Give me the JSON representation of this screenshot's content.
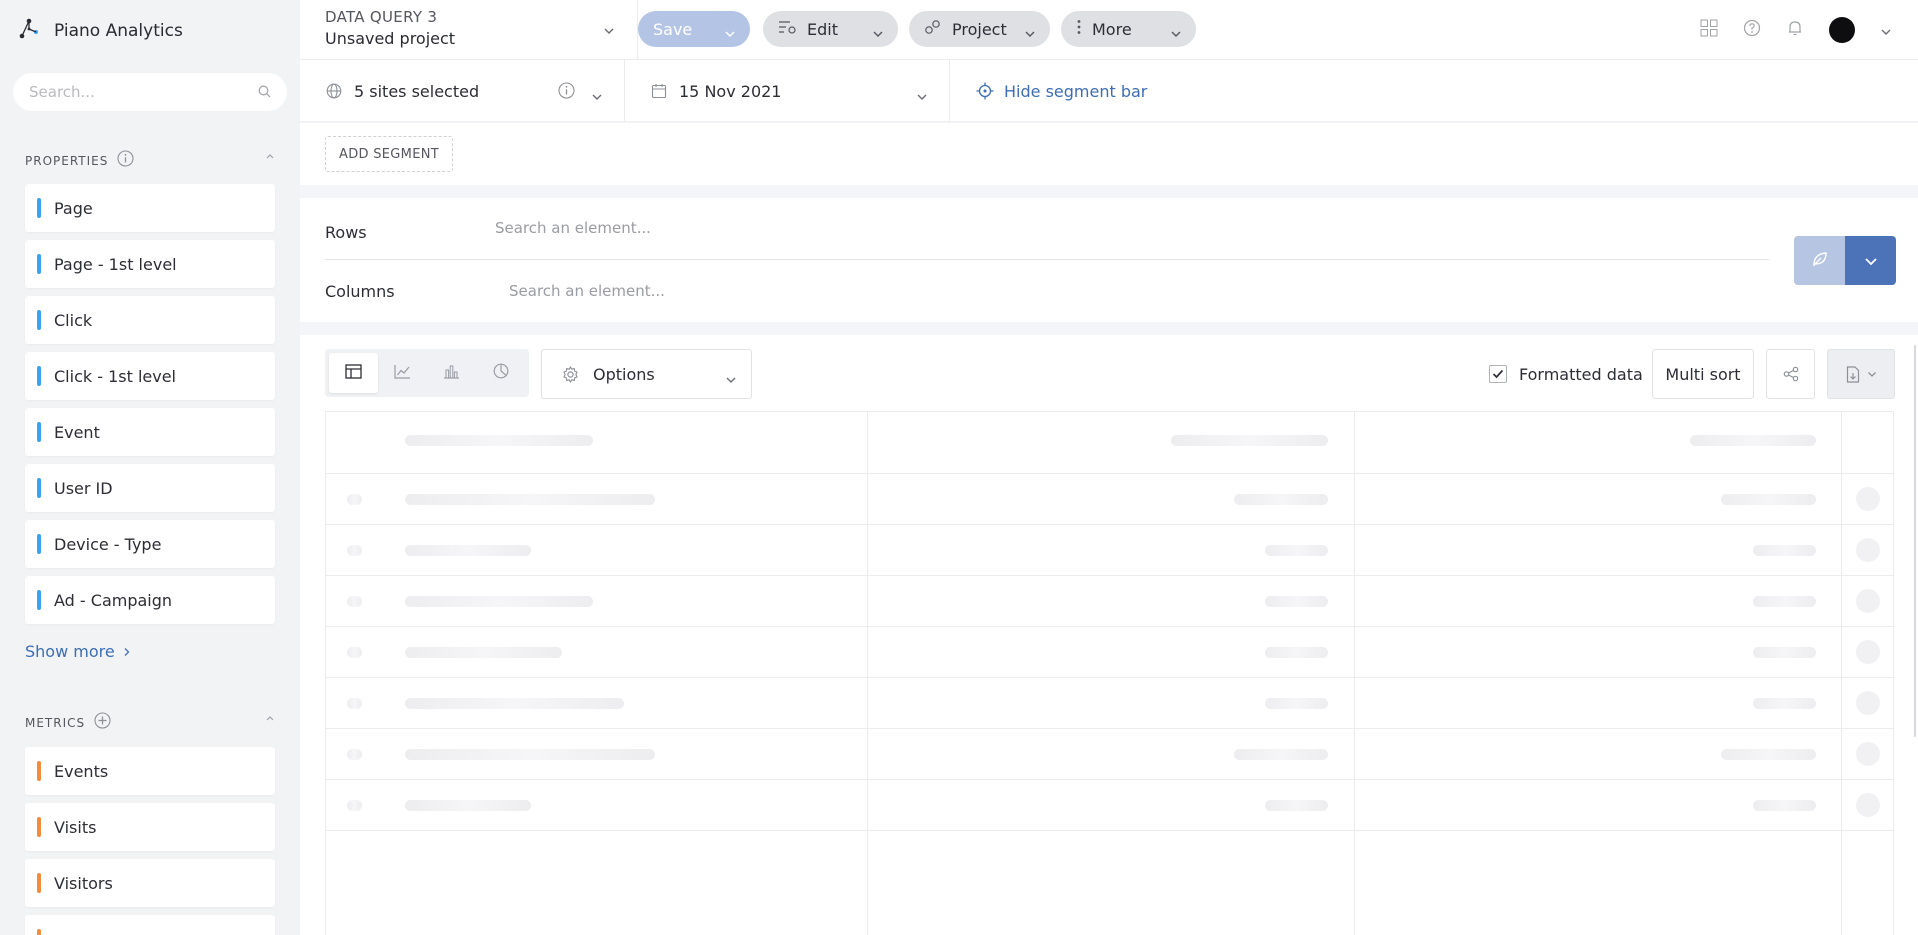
{
  "app": {
    "name": "Piano Analytics"
  },
  "sidebar": {
    "search_placeholder": "Search...",
    "properties_title": "PROPERTIES",
    "properties": [
      "Page",
      "Page - 1st level",
      "Click",
      "Click - 1st level",
      "Event",
      "User ID",
      "Device - Type",
      "Ad - Campaign"
    ],
    "show_more": "Show more",
    "metrics_title": "METRICS",
    "metrics": [
      "Events",
      "Visits",
      "Visitors"
    ]
  },
  "topbar": {
    "query_kicker": "DATA QUERY 3",
    "project_name": "Unsaved project",
    "save": "Save",
    "edit": "Edit",
    "project": "Project",
    "more": "More"
  },
  "filters": {
    "sites": "5 sites selected",
    "date": "15 Nov 2021",
    "segment_toggle": "Hide segment bar",
    "add_segment": "ADD SEGMENT"
  },
  "query": {
    "rows_label": "Rows",
    "rows_placeholder": "Search an element...",
    "columns_label": "Columns",
    "columns_placeholder": "Search an element..."
  },
  "results": {
    "options_label": "Options",
    "formatted_data": "Formatted data",
    "formatted_checked": true,
    "multi_sort": "Multi sort"
  },
  "colors": {
    "accent": "#4c72b8",
    "link": "#3d6eb5",
    "property_marker": "#3aa3f0",
    "metric_marker": "#f58c3d"
  },
  "icons": [
    "logo-icon",
    "search-icon",
    "info-icon",
    "add-circle-icon",
    "chevron-down-icon",
    "chevron-up-icon",
    "chevron-right-icon",
    "edit-icon",
    "project-icon",
    "more-icon",
    "grid-icon",
    "help-icon",
    "bell-icon",
    "globe-icon",
    "calendar-icon",
    "target-icon",
    "leaf-icon",
    "table-icon",
    "line-chart-icon",
    "bar-chart-icon",
    "pie-chart-icon",
    "gear-icon",
    "check-icon",
    "share-icon",
    "export-icon"
  ]
}
